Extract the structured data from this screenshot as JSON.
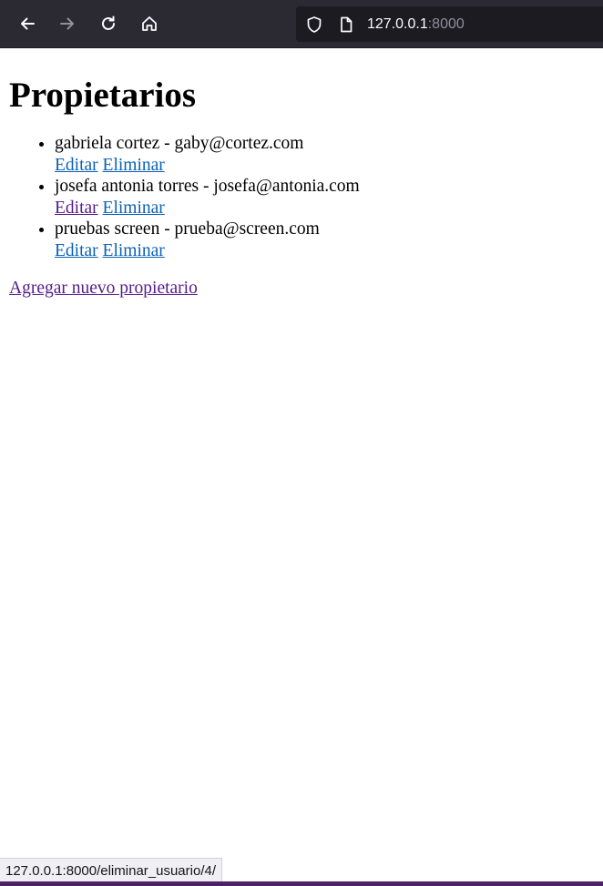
{
  "browser": {
    "url_host": "127.0.0.1",
    "url_port": ":8000",
    "icons": {
      "back": "arrow-left-icon",
      "forward": "arrow-right-icon",
      "reload": "reload-icon",
      "home": "home-icon",
      "shield": "shield-icon",
      "page": "page-icon"
    },
    "status_url": "127.0.0.1:8000/eliminar_usuario/4/"
  },
  "page": {
    "title": "Propietarios",
    "owners": [
      {
        "text": "gabriela cortez - gaby@cortez.com",
        "edit_label": "Editar",
        "delete_label": "Eliminar"
      },
      {
        "text": "josefa antonia torres - josefa@antonia.com",
        "edit_label": "Editar",
        "delete_label": "Eliminar"
      },
      {
        "text": "pruebas screen - prueba@screen.com",
        "edit_label": "Editar",
        "delete_label": "Eliminar"
      }
    ],
    "add_link_label": "Agregar nuevo propietario"
  },
  "colors": {
    "toolbar_bg": "#2b2a33",
    "urlbar_bg": "#1c1b22",
    "link": "#0a61b5",
    "visited_link": "#551a8b"
  }
}
